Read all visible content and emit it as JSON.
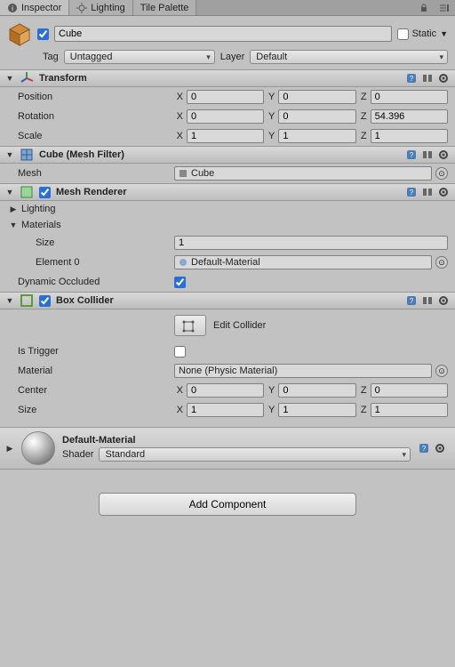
{
  "tabs": {
    "inspector": "Inspector",
    "lighting": "Lighting",
    "tilepalette": "Tile Palette"
  },
  "header": {
    "name": "Cube",
    "static_label": "Static"
  },
  "taglayer": {
    "tag_label": "Tag",
    "tag_value": "Untagged",
    "layer_label": "Layer",
    "layer_value": "Default"
  },
  "transform": {
    "title": "Transform",
    "pos_label": "Position",
    "rot_label": "Rotation",
    "scale_label": "Scale",
    "pos": {
      "x": "0",
      "y": "0",
      "z": "0"
    },
    "rot": {
      "x": "0",
      "y": "0",
      "z": "54.396"
    },
    "scale": {
      "x": "1",
      "y": "1",
      "z": "1"
    }
  },
  "meshfilter": {
    "title": "Cube (Mesh Filter)",
    "mesh_label": "Mesh",
    "mesh_value": "Cube"
  },
  "meshrenderer": {
    "title": "Mesh Renderer",
    "lighting_label": "Lighting",
    "materials_label": "Materials",
    "size_label": "Size",
    "size_value": "1",
    "element0_label": "Element 0",
    "element0_value": "Default-Material",
    "dyn_occ_label": "Dynamic Occluded"
  },
  "boxcollider": {
    "title": "Box Collider",
    "edit_label": "Edit Collider",
    "istrigger_label": "Is Trigger",
    "material_label": "Material",
    "material_value": "None (Physic Material)",
    "center_label": "Center",
    "center": {
      "x": "0",
      "y": "0",
      "z": "0"
    },
    "size_label": "Size",
    "size": {
      "x": "1",
      "y": "1",
      "z": "1"
    }
  },
  "material": {
    "name": "Default-Material",
    "shader_label": "Shader",
    "shader_value": "Standard"
  },
  "addcomponent": "Add Component",
  "axis": {
    "x": "X",
    "y": "Y",
    "z": "Z"
  }
}
